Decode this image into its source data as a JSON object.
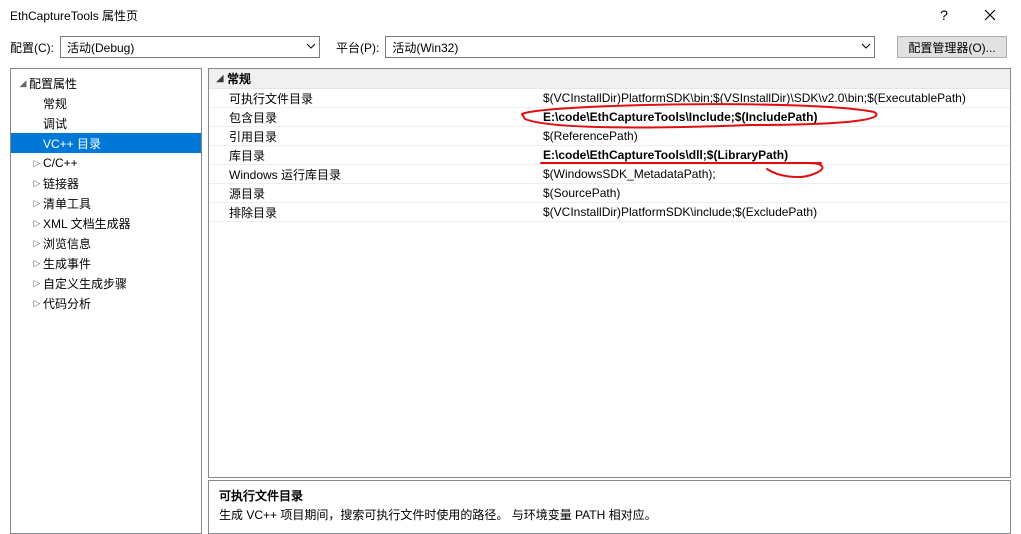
{
  "window": {
    "title": "EthCaptureTools 属性页"
  },
  "topbar": {
    "config_label": "配置(C):",
    "config_value": "活动(Debug)",
    "platform_label": "平台(P):",
    "platform_value": "活动(Win32)",
    "manager_button": "配置管理器(O)..."
  },
  "tree": {
    "root": "配置属性",
    "items": [
      {
        "label": "常规",
        "expandable": false
      },
      {
        "label": "调试",
        "expandable": false
      },
      {
        "label": "VC++ 目录",
        "expandable": false,
        "selected": true
      },
      {
        "label": "C/C++",
        "expandable": true
      },
      {
        "label": "链接器",
        "expandable": true
      },
      {
        "label": "清单工具",
        "expandable": true
      },
      {
        "label": "XML 文档生成器",
        "expandable": true
      },
      {
        "label": "浏览信息",
        "expandable": true
      },
      {
        "label": "生成事件",
        "expandable": true
      },
      {
        "label": "自定义生成步骤",
        "expandable": true
      },
      {
        "label": "代码分析",
        "expandable": true
      }
    ]
  },
  "grid": {
    "category": "常规",
    "rows": [
      {
        "label": "可执行文件目录",
        "value": "$(VCInstallDir)PlatformSDK\\bin;$(VSInstallDir)\\SDK\\v2.0\\bin;$(ExecutablePath)",
        "bold": false
      },
      {
        "label": "包含目录",
        "value": "E:\\code\\EthCaptureTools\\Include;$(IncludePath)",
        "bold": true
      },
      {
        "label": "引用目录",
        "value": "$(ReferencePath)",
        "bold": false
      },
      {
        "label": "库目录",
        "value": "E:\\code\\EthCaptureTools\\dll;$(LibraryPath)",
        "bold": true
      },
      {
        "label": "Windows 运行库目录",
        "value": "$(WindowsSDK_MetadataPath);",
        "bold": false
      },
      {
        "label": "源目录",
        "value": "$(SourcePath)",
        "bold": false
      },
      {
        "label": "排除目录",
        "value": "$(VCInstallDir)PlatformSDK\\include;$(ExcludePath)",
        "bold": false
      }
    ]
  },
  "description": {
    "title": "可执行文件目录",
    "text": "生成 VC++ 项目期间，搜索可执行文件时使用的路径。    与环境变量 PATH 相对应。"
  }
}
